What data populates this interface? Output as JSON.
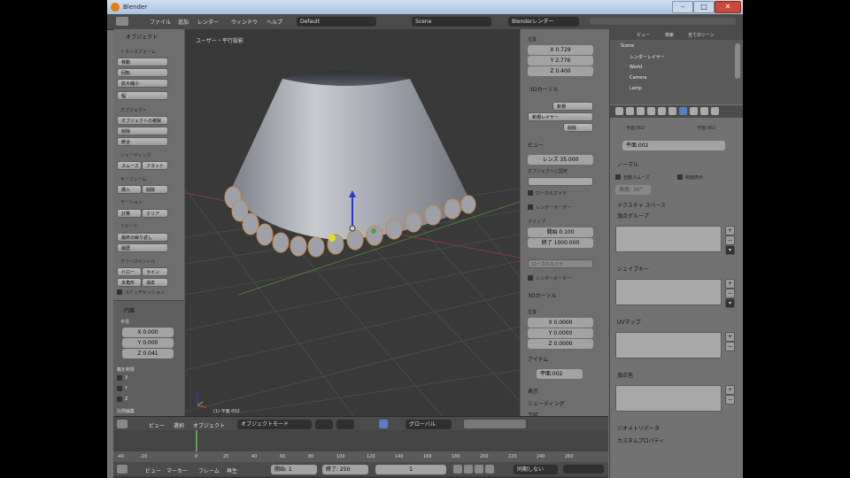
{
  "window": {
    "title": "Blender"
  },
  "menubar": {
    "menus": [
      "ファイル",
      "追加",
      "レンダー",
      "ウィンドウ",
      "ヘルプ"
    ],
    "layout_value": "Default",
    "scene_value": "Scene",
    "engine_value": "Blenderレンダー"
  },
  "toolshelf": {
    "header": "オブジェクト",
    "transform_header": "トランスフォーム",
    "transform_buttons": [
      "移動",
      "回転",
      "拡大縮小",
      "幅"
    ],
    "object_header": "オブジェクト",
    "object_buttons": [
      "オブジェクトの複製",
      "削除",
      "統合"
    ],
    "shading_header": "シェーディング",
    "shading_buttons": [
      "スムーズ",
      "フラット"
    ],
    "keyframe_header": "キーフレーム",
    "keyframe_buttons": [
      "挿入",
      "削除"
    ],
    "motion_header": "モーション",
    "motion_buttons": [
      "計算",
      "クリア"
    ],
    "repeat_header": "リピート",
    "repeat_buttons": [
      "最終の繰り返し",
      "履歴"
    ],
    "grease_header": "グリースペンシル",
    "grease_buttons": [
      "ドロー",
      "ライン",
      "多角形",
      "消去"
    ],
    "grease_checkbox": "スケッチセッション",
    "op_header": "円錐",
    "op_group_label": "半径",
    "op_values": [
      "X 0.000",
      "Y 0.000",
      "Z 0.041"
    ],
    "op_checks_label": "軸を制限",
    "op_checks": [
      "X",
      "Y",
      "Z"
    ],
    "op_footer": "比例編集"
  },
  "viewport": {
    "view_label": "ユーザー・平行投影",
    "object_label": "(1) 平面.002"
  },
  "npanel": {
    "loc_label": "位置",
    "loc_values": [
      "X 0.729",
      "Y 2.776",
      "Z 0.400"
    ],
    "cursor_label": "3Dカーソル",
    "layers_buttons": [
      "新規",
      "削除"
    ],
    "layer_value": "新規レイヤー",
    "view_header": "ビュー",
    "lens_value": "レンズ 35.000",
    "lock_label": "オブジェクトに固定",
    "local_camera": "ローカルカメラ",
    "render_border": "レンダーボーダー",
    "clip_label": "クリップ",
    "clip_start": "開始 0.100",
    "clip_end": "終了 1000.000",
    "local_cam_value": "ローカルカメラ",
    "render_border_btn": "レンダーボーダー",
    "cursor3d_label": "3Dカーソル",
    "cursor_pos_label": "位置",
    "cursor_values": [
      "X 0.0000",
      "Y 0.0000",
      "Z 0.0000"
    ],
    "item_header": "アイテム",
    "item_value": "平面.002",
    "display_header": "表示",
    "shading_header": "シェーディング",
    "bg_header": "下絵"
  },
  "outliner": {
    "tabs": [
      "ビュー",
      "検索",
      "全てのシーン"
    ],
    "items": [
      "Scene",
      "レンダーレイヤー",
      "World",
      "Camera",
      "Lamp"
    ]
  },
  "props": {
    "object_name": "平面.002",
    "mesh_name": "平面.002",
    "normals_header": "ノーマル",
    "auto_smooth": "自動スムーズ",
    "double_sided": "両面表示",
    "angle_value": "角度: 30°",
    "texspace_header": "テクスチャ スペース",
    "vgroups_header": "頂点グループ",
    "shapekeys_header": "シェイプキー",
    "uvmaps_header": "UVマップ",
    "vcolors_header": "頂点色",
    "geometry_header": "ジオメトリデータ",
    "custom_header": "カスタムプロパティ"
  },
  "vp_header": {
    "menus": [
      "ビュー",
      "選択",
      "オブジェクト"
    ],
    "mode_value": "オブジェクトモード",
    "orientation_value": "グローバル"
  },
  "timeline": {
    "ruler": [
      "-40",
      "-20",
      "0",
      "20",
      "40",
      "60",
      "80",
      "100",
      "120",
      "140",
      "160",
      "180",
      "200",
      "220",
      "240",
      "260"
    ],
    "menus": [
      "ビュー",
      "マーカー",
      "フレーム",
      "再生"
    ],
    "start_value": "開始: 1",
    "end_value": "終了: 250",
    "current_value": "1",
    "sync_value": "同期しない"
  },
  "colors": {
    "accent": "#e87d0d",
    "selected": "#5680c2",
    "viewport_bg": "#393939"
  }
}
